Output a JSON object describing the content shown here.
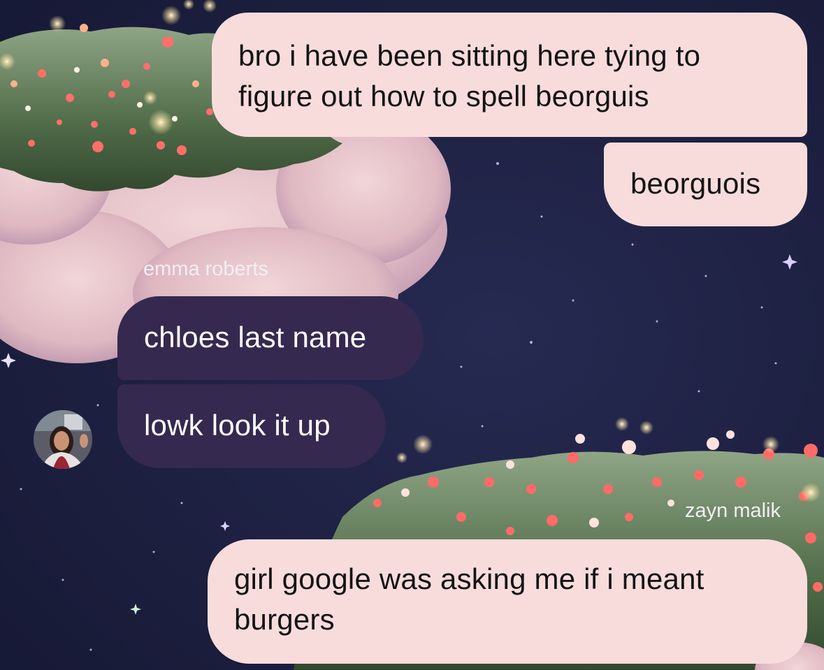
{
  "messages": [
    {
      "id": "m1",
      "direction": "outgoing",
      "text": "bro i have been sitting here tying to figure out how to spell beorguis"
    },
    {
      "id": "m2",
      "direction": "outgoing",
      "text": "beorguois"
    },
    {
      "id": "m3",
      "direction": "incoming",
      "sender": "emma roberts",
      "text": "chloes last name"
    },
    {
      "id": "m4",
      "direction": "incoming",
      "text": "lowk look it up",
      "avatar": "profile-photo"
    },
    {
      "id": "m5",
      "direction": "outgoing",
      "sender": "zayn malik",
      "text": "girl google was asking me if i meant burgers"
    }
  ],
  "colors": {
    "background": "#1e2142",
    "outgoing_bubble": "#f8dcdc",
    "incoming_bubble": "#35294f",
    "outgoing_text": "#141414",
    "incoming_text": "#ffffff",
    "cloud": "#e8c4cc",
    "grass": "#5c7a52"
  }
}
